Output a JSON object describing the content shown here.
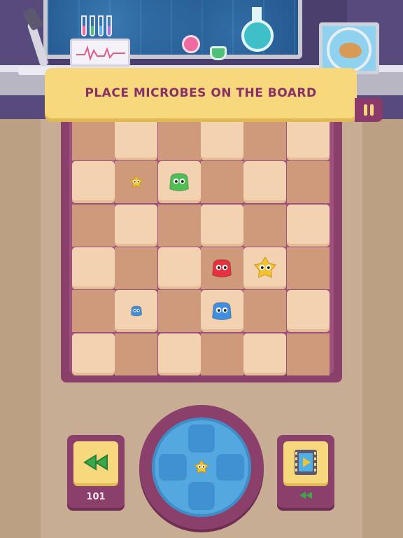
{
  "banner": {
    "title": "PLACE MICROBES ON THE BOARD"
  },
  "controls": {
    "undo_count": "101",
    "pause_icon": "pause-icon",
    "undo_icon": "rewind-icon",
    "video_icon": "film-play-icon"
  },
  "board": {
    "rows": 6,
    "cols": 6,
    "pieces": [
      {
        "type": "star-microbe",
        "color": "#f2c230",
        "row": 1,
        "col": 1,
        "size": "small"
      },
      {
        "type": "blob-microbe",
        "color": "#4fbf55",
        "row": 1,
        "col": 2,
        "size": "medium"
      },
      {
        "type": "blob-microbe",
        "color": "#e8303e",
        "row": 3,
        "col": 3,
        "size": "medium"
      },
      {
        "type": "star-microbe",
        "color": "#f2c230",
        "row": 3,
        "col": 4,
        "size": "medium"
      },
      {
        "type": "blob-microbe",
        "color": "#3f8fe0",
        "row": 4,
        "col": 1,
        "size": "small"
      },
      {
        "type": "blob-microbe",
        "color": "#3f8fe0",
        "row": 4,
        "col": 3,
        "size": "medium"
      }
    ]
  },
  "dpad": {
    "center_piece": {
      "type": "star-microbe",
      "color": "#f2c230"
    }
  },
  "colors": {
    "accent": "#8b3f6b",
    "banner": "#f8d87d",
    "banner_text": "#8a2f64",
    "screen": "#1f4f88"
  }
}
